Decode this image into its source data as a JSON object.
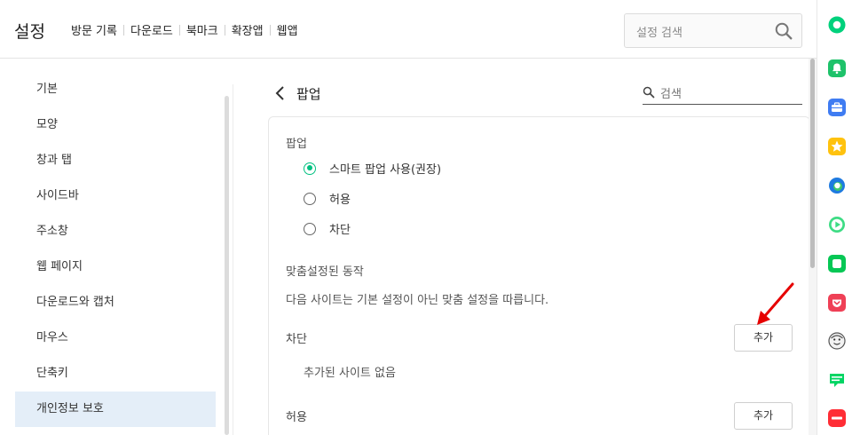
{
  "header": {
    "title": "설정",
    "nav": [
      "방문 기록",
      "다운로드",
      "북마크",
      "확장앱",
      "웹앱"
    ],
    "search_placeholder": "설정 검색"
  },
  "sidebar": {
    "items": [
      {
        "label": "기본"
      },
      {
        "label": "모양"
      },
      {
        "label": "창과 탭"
      },
      {
        "label": "사이드바"
      },
      {
        "label": "주소창"
      },
      {
        "label": "웹 페이지"
      },
      {
        "label": "다운로드와 캡처"
      },
      {
        "label": "마우스"
      },
      {
        "label": "단축키"
      },
      {
        "label": "개인정보 보호",
        "active": true
      }
    ]
  },
  "page": {
    "title": "팝업",
    "search_placeholder": "검색"
  },
  "popup": {
    "label": "팝업",
    "options": [
      {
        "label": "스마트 팝업 사용(권장)",
        "checked": true
      },
      {
        "label": "허용",
        "checked": false
      },
      {
        "label": "차단",
        "checked": false
      }
    ]
  },
  "custom": {
    "label": "맞춤설정된 동작",
    "description": "다음 사이트는 기본 설정이 아닌 맞춤 설정을 따릅니다.",
    "block_label": "차단",
    "block_add": "추가",
    "block_empty": "추가된 사이트 없음",
    "allow_label": "허용",
    "allow_add": "추가"
  },
  "colors": {
    "accent": "#00c080",
    "active_nav_bg": "#e4eef8",
    "annotation_arrow": "#e60000"
  },
  "right_bar_icons": [
    "whale-logo-icon",
    "bell-icon",
    "briefcase-icon",
    "star-icon",
    "edge-icon",
    "play-icon",
    "line-icon",
    "pocket-icon",
    "avatar-icon",
    "webtoon-icon",
    "now-icon"
  ]
}
